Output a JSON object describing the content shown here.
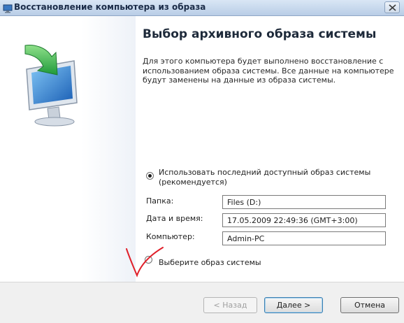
{
  "window": {
    "title": "Восстановление компьютера из образа"
  },
  "page": {
    "heading": "Выбор архивного образа системы",
    "description": "Для этого компьютера будет выполнено восстановление с использованием образа системы. Все данные на компьютере будут заменены на данные из образа системы."
  },
  "options": {
    "use_latest": {
      "label": "Использовать последний доступный образ системы (рекомендуется)",
      "selected": true
    },
    "select_image": {
      "label": "Выберите образ системы",
      "selected": false
    }
  },
  "details": {
    "folder_label": "Папка:",
    "folder_value": "Files (D:)",
    "datetime_label": "Дата и время:",
    "datetime_value": "17.05.2009 22:49:36 (GMT+3:00)",
    "computer_label": "Компьютер:",
    "computer_value": "Admin-PC"
  },
  "buttons": {
    "back": "< Назад",
    "next": "Далее >",
    "cancel": "Отмена"
  },
  "colors": {
    "annotation": "#e0202a",
    "titlebar": "#c9daee"
  },
  "icons": {
    "title": "restore-window-icon",
    "side": "computer-restore-icon",
    "close": "close-icon"
  }
}
